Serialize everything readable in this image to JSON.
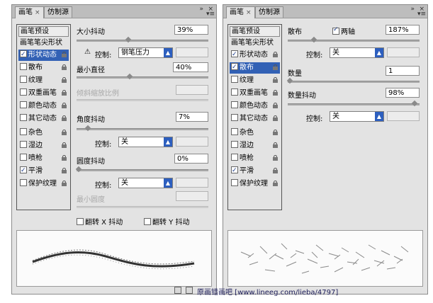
{
  "left_panel": {
    "tabs": [
      {
        "label": "画笔",
        "close": "×"
      },
      {
        "label": "仿制源"
      }
    ],
    "titlebar_controls": {
      "collapse": "»",
      "close": "×",
      "menu": "▾≡"
    },
    "list": {
      "header": "画笔预设",
      "items": [
        {
          "label": "画笔笔尖形状",
          "checkbox": false,
          "lock": false,
          "selected": false,
          "checked": false
        },
        {
          "label": "形状动态",
          "checkbox": true,
          "lock": true,
          "selected": true,
          "checked": true
        },
        {
          "label": "散布",
          "checkbox": true,
          "lock": true,
          "selected": false,
          "checked": false
        },
        {
          "label": "纹理",
          "checkbox": true,
          "lock": true,
          "selected": false,
          "checked": false
        },
        {
          "label": "双重画笔",
          "checkbox": true,
          "lock": true,
          "selected": false,
          "checked": false
        },
        {
          "label": "颜色动态",
          "checkbox": true,
          "lock": true,
          "selected": false,
          "checked": false
        },
        {
          "label": "其它动态",
          "checkbox": true,
          "lock": true,
          "selected": false,
          "checked": false
        },
        {
          "label": "杂色",
          "checkbox": true,
          "lock": true,
          "selected": false,
          "checked": false
        },
        {
          "label": "湿边",
          "checkbox": true,
          "lock": true,
          "selected": false,
          "checked": false
        },
        {
          "label": "喷枪",
          "checkbox": true,
          "lock": true,
          "selected": false,
          "checked": false
        },
        {
          "label": "平滑",
          "checkbox": true,
          "lock": true,
          "selected": false,
          "checked": true
        },
        {
          "label": "保护纹理",
          "checkbox": true,
          "lock": true,
          "selected": false,
          "checked": false
        }
      ]
    },
    "settings": {
      "size_jitter": {
        "label": "大小抖动",
        "value": "39%"
      },
      "size_control": {
        "warn": "⚠",
        "label": "控制:",
        "option": "钢笔压力"
      },
      "min_diameter": {
        "label": "最小直径",
        "value": "40%"
      },
      "tilt_scale": {
        "label": "倾斜缩放比例"
      },
      "angle_jitter": {
        "label": "角度抖动",
        "value": "7%"
      },
      "angle_control": {
        "label": "控制:",
        "option": "关"
      },
      "roundness_jitter": {
        "label": "圆度抖动",
        "value": "0%"
      },
      "roundness_control": {
        "label": "控制:",
        "option": "关"
      },
      "min_roundness": {
        "label": "最小圆度"
      },
      "flip_x": {
        "label": "翻转 X 抖动"
      },
      "flip_y": {
        "label": "翻转 Y 抖动"
      }
    }
  },
  "right_panel": {
    "tabs": [
      {
        "label": "画笔",
        "close": "×"
      },
      {
        "label": "仿制源"
      }
    ],
    "titlebar_controls": {
      "collapse": "»",
      "close": "×",
      "menu": "▾≡"
    },
    "list": {
      "header": "画笔预设",
      "items": [
        {
          "label": "画笔笔尖形状",
          "checkbox": false,
          "lock": false,
          "selected": false,
          "checked": false
        },
        {
          "label": "形状动态",
          "checkbox": true,
          "lock": true,
          "selected": false,
          "checked": true
        },
        {
          "label": "散布",
          "checkbox": true,
          "lock": true,
          "selected": true,
          "checked": true
        },
        {
          "label": "纹理",
          "checkbox": true,
          "lock": true,
          "selected": false,
          "checked": false
        },
        {
          "label": "双重画笔",
          "checkbox": true,
          "lock": true,
          "selected": false,
          "checked": false
        },
        {
          "label": "颜色动态",
          "checkbox": true,
          "lock": true,
          "selected": false,
          "checked": false
        },
        {
          "label": "其它动态",
          "checkbox": true,
          "lock": true,
          "selected": false,
          "checked": false
        },
        {
          "label": "杂色",
          "checkbox": true,
          "lock": true,
          "selected": false,
          "checked": false
        },
        {
          "label": "湿边",
          "checkbox": true,
          "lock": true,
          "selected": false,
          "checked": false
        },
        {
          "label": "喷枪",
          "checkbox": true,
          "lock": true,
          "selected": false,
          "checked": false
        },
        {
          "label": "平滑",
          "checkbox": true,
          "lock": true,
          "selected": false,
          "checked": true
        },
        {
          "label": "保护纹理",
          "checkbox": true,
          "lock": true,
          "selected": false,
          "checked": false
        }
      ]
    },
    "settings": {
      "scatter": {
        "label": "散布",
        "both_axes": "两轴",
        "value": "187%"
      },
      "scatter_control": {
        "label": "控制:",
        "option": "关"
      },
      "count": {
        "label": "数量",
        "value": "1"
      },
      "count_jitter": {
        "label": "数量抖动",
        "value": "98%"
      },
      "count_control": {
        "label": "控制:",
        "option": "关"
      }
    }
  },
  "slider_levels": {
    "size_jitter": 0.39,
    "min_diameter": 0.4,
    "angle_jitter": 0.07,
    "roundness_jitter": 0.0,
    "scatter": 0.187,
    "count": 0.0,
    "count_jitter": 0.98
  },
  "footer": {
    "watermark": "原画错画吧 [www.lineeg.com/lieba/4797]"
  },
  "colors": {
    "selection": "#3261b5",
    "panel": "#e3e3e3",
    "dropdown_arrow": "#2d5fbf"
  },
  "icons": [
    "lock-icon",
    "checkbox-icon",
    "warning-icon",
    "dropdown-arrow-icon",
    "new-brush-icon",
    "trash-icon",
    "panel-menu-icon"
  ]
}
